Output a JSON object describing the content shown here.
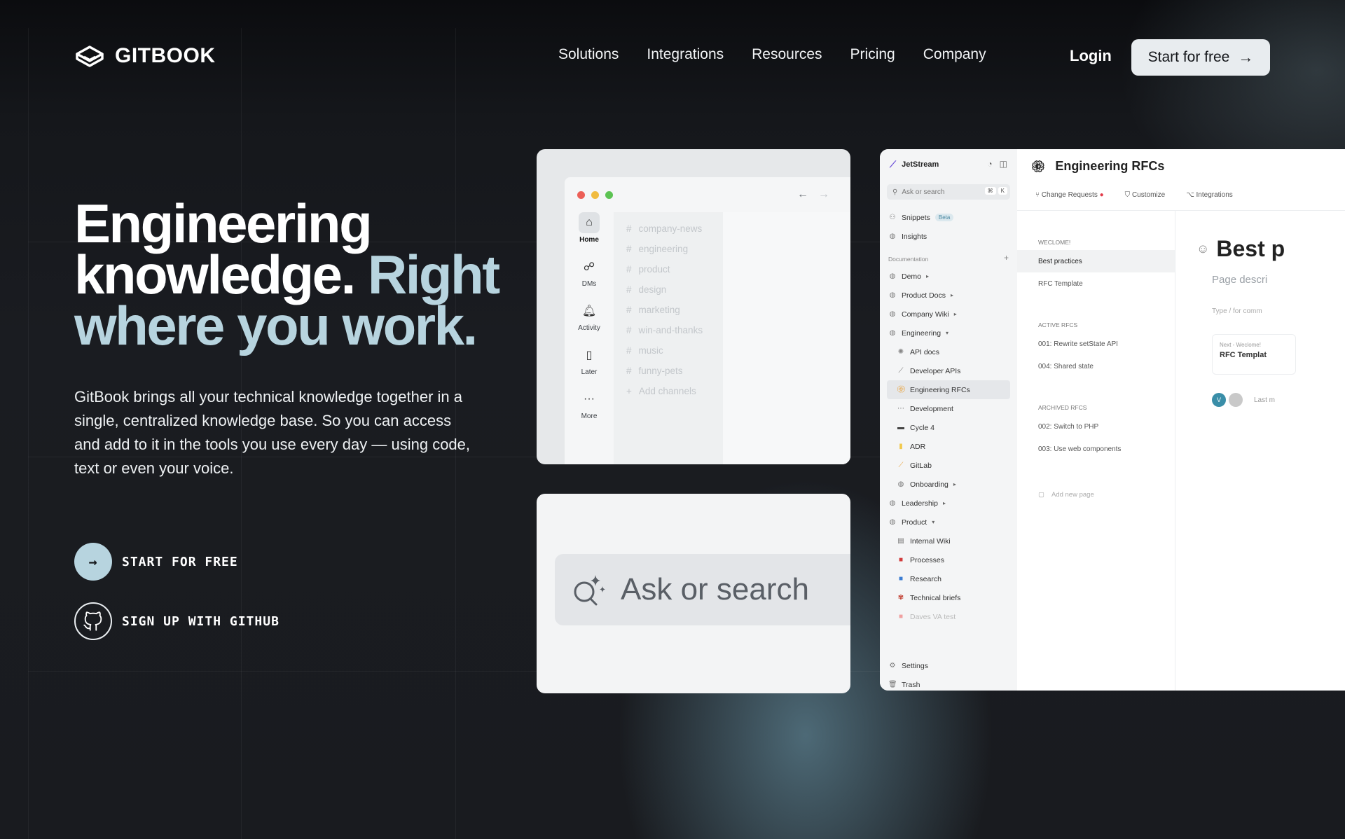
{
  "brand": {
    "name": "GITBOOK"
  },
  "nav": {
    "links": [
      "Solutions",
      "Integrations",
      "Resources",
      "Pricing",
      "Company"
    ],
    "login": "Login",
    "cta": "Start for free"
  },
  "hero": {
    "title_line1": "Engineering",
    "title_line2": "knowledge.",
    "title_accent_inline": "Right",
    "title_accent_line": "where you work.",
    "description": "GitBook brings all your technical knowledge together in a single, centralized knowledge base. So you can access and add to it in the tools you use every day — using code, text or even your voice.",
    "primary_action": "START FOR FREE",
    "secondary_action": "SIGN UP WITH GITHUB"
  },
  "slack_card": {
    "sidebar": [
      {
        "label": "Home",
        "icon": "home-icon"
      },
      {
        "label": "DMs",
        "icon": "dms-icon"
      },
      {
        "label": "Activity",
        "icon": "bell-icon"
      },
      {
        "label": "Later",
        "icon": "bookmark-icon"
      },
      {
        "label": "More",
        "icon": "more-icon"
      }
    ],
    "channels": [
      "company-news",
      "engineering",
      "product",
      "design",
      "marketing",
      "win-and-thanks",
      "music",
      "funny-pets"
    ],
    "add_channels": "Add channels"
  },
  "search_card": {
    "placeholder": "Ask or search"
  },
  "app_card": {
    "org": "JetStream",
    "search_placeholder": "Ask or search",
    "search_keys": [
      "⌘",
      "K"
    ],
    "top_items": [
      "Snippets",
      "Insights"
    ],
    "snippets_badge": "Beta",
    "documentation_label": "Documentation",
    "spaces": [
      {
        "label": "Demo",
        "sub": false,
        "chev": "right"
      },
      {
        "label": "Product Docs",
        "sub": false,
        "chev": "right"
      },
      {
        "label": "Company Wiki",
        "sub": false,
        "chev": "right"
      },
      {
        "label": "Engineering",
        "sub": false,
        "chev": "down"
      },
      {
        "label": "API docs",
        "sub": true
      },
      {
        "label": "Developer APIs",
        "sub": true
      },
      {
        "label": "Engineering RFCs",
        "sub": true,
        "active": true
      },
      {
        "label": "Development",
        "sub": true
      },
      {
        "label": "Cycle 4",
        "sub": true
      },
      {
        "label": "ADR",
        "sub": true
      },
      {
        "label": "GitLab",
        "sub": true
      },
      {
        "label": "Onboarding",
        "sub": true,
        "chev": "right"
      },
      {
        "label": "Leadership",
        "sub": false,
        "chev": "right"
      },
      {
        "label": "Product",
        "sub": false,
        "chev": "down"
      },
      {
        "label": "Internal Wiki",
        "sub": true
      },
      {
        "label": "Processes",
        "sub": true
      },
      {
        "label": "Research",
        "sub": true
      },
      {
        "label": "Technical briefs",
        "sub": true
      },
      {
        "label": "Daves VA test",
        "sub": true,
        "faded": true
      }
    ],
    "bottom_items": [
      "Settings",
      "Trash"
    ],
    "space_title": "Engineering RFCs",
    "tabs": [
      "Change Requests",
      "Customize",
      "Integrations"
    ],
    "groups": [
      {
        "label": "WECLOME!",
        "pages": [
          "Best practices",
          "RFC Template"
        ]
      },
      {
        "label": "ACTIVE RFCS",
        "pages": [
          "001: Rewrite setState API",
          "004: Shared state"
        ]
      },
      {
        "label": "ARCHIVED RFCS",
        "pages": [
          "002: Switch to PHP",
          "003: Use web components"
        ]
      }
    ],
    "add_page": "Add new page",
    "page_heading": "Best p",
    "page_desc": "Page descri",
    "type_hint": "Type  /  for comm",
    "next_small": "Next - Weclome!",
    "next_title": "RFC Templat",
    "avatar_initial": "V",
    "last_modified": "Last m"
  },
  "colors": {
    "accent": "#b7d4df",
    "background": "#17191d"
  }
}
